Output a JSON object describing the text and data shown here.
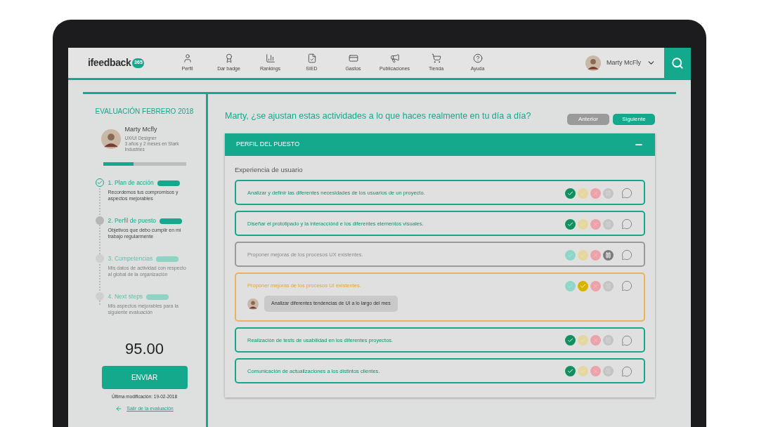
{
  "nav": {
    "logo": "ifeedback",
    "logo_badge": "365",
    "items": [
      {
        "label": "Perfil",
        "kind": "user"
      },
      {
        "label": "Dar badge",
        "kind": "award"
      },
      {
        "label": "Rankings",
        "kind": "chart"
      },
      {
        "label": "SIED",
        "kind": "file"
      },
      {
        "label": "Gastos",
        "kind": "card"
      },
      {
        "label": "Publicaciones",
        "kind": "megaphone"
      },
      {
        "label": "Tienda",
        "kind": "cart"
      },
      {
        "label": "Ayuda",
        "kind": "help"
      }
    ],
    "user": "Marty McFly"
  },
  "sidebar": {
    "title": "EVALUACIÓN FEBRERO 2018",
    "name": "Marty Mcfly",
    "role": "UX/UI Designer",
    "tenure": "3 años y 2 meses en Stark Industries",
    "progress": {
      "level": 0.37
    },
    "steps": [
      {
        "title": "1. Plan de acción",
        "text": "Recordemos tus compromisos y aspectos mejorables",
        "completed": true,
        "disabled": false
      },
      {
        "title": "2. Perfil de puesto",
        "text": "Objetivos que debo cumplir en mi trabajo regularmente",
        "completed": false,
        "disabled": false
      },
      {
        "title": "3. Competencias",
        "text": "Mis datos de actividad con respecto al global de la organización",
        "completed": false,
        "disabled": true
      },
      {
        "title": "4. Next steps",
        "text": "Mis aspectos mejorables para la siguiente evaluación",
        "completed": false,
        "disabled": true
      }
    ],
    "score": "95.00",
    "submit": "ENVIAR",
    "modified": "Última modificación: 19-02-2018",
    "exit": "Salir de la evaluación"
  },
  "main": {
    "question": "Marty, ¿se ajustan estas actividades a lo que haces realmente en tu día a día?",
    "prev": "Anterior",
    "next": "Siguiente",
    "section": {
      "title": "PERFIL DEL PUESTO",
      "expanded": true,
      "group": "Experiencia de usuario",
      "rows": [
        {
          "text": "Analizar y definir las diferentes necesidades de los usuarios de un proyecto.",
          "kind": "done",
          "choices": [
            {
              "kind": "yes",
              "selected": true
            },
            {
              "kind": "partial",
              "selected": false
            },
            {
              "kind": "no",
              "selected": false
            },
            {
              "kind": "pause",
              "selected": false
            }
          ]
        },
        {
          "text": "Diseñar el prototipado y la interacciónd e los diferentes elementos visuales.",
          "kind": "done",
          "choices": [
            {
              "kind": "yes",
              "selected": true
            },
            {
              "kind": "partial",
              "selected": false
            },
            {
              "kind": "no",
              "selected": false
            },
            {
              "kind": "pause",
              "selected": false
            }
          ]
        },
        {
          "text": "Proponer mejoras de los procesos UX existentes.",
          "kind": "paused",
          "choices": [
            {
              "kind": "yes",
              "selected": false
            },
            {
              "kind": "partial",
              "selected": false
            },
            {
              "kind": "no",
              "selected": false
            },
            {
              "kind": "pause",
              "selected": true
            }
          ]
        },
        {
          "text": "Proponer mejoras de los procesos UI existentes.",
          "kind": "partial",
          "comment": "Analizar diferentes tendencias de UI a lo largo del mes",
          "choices": [
            {
              "kind": "yes",
              "selected": false
            },
            {
              "kind": "partial",
              "selected": true
            },
            {
              "kind": "no",
              "selected": false
            },
            {
              "kind": "pause",
              "selected": false
            }
          ]
        },
        {
          "text": "Realización de tests de usabilidad en los diferentes proyectos.",
          "kind": "done",
          "choices": [
            {
              "kind": "yes",
              "selected": true
            },
            {
              "kind": "partial",
              "selected": false
            },
            {
              "kind": "no",
              "selected": false
            },
            {
              "kind": "pause",
              "selected": false
            }
          ]
        },
        {
          "text": "Comunicación de actualizaciones a los distintos clientes.",
          "kind": "done",
          "choices": [
            {
              "kind": "yes",
              "selected": true
            },
            {
              "kind": "partial",
              "selected": false
            },
            {
              "kind": "no",
              "selected": false
            },
            {
              "kind": "pause",
              "selected": false
            }
          ]
        }
      ]
    }
  }
}
